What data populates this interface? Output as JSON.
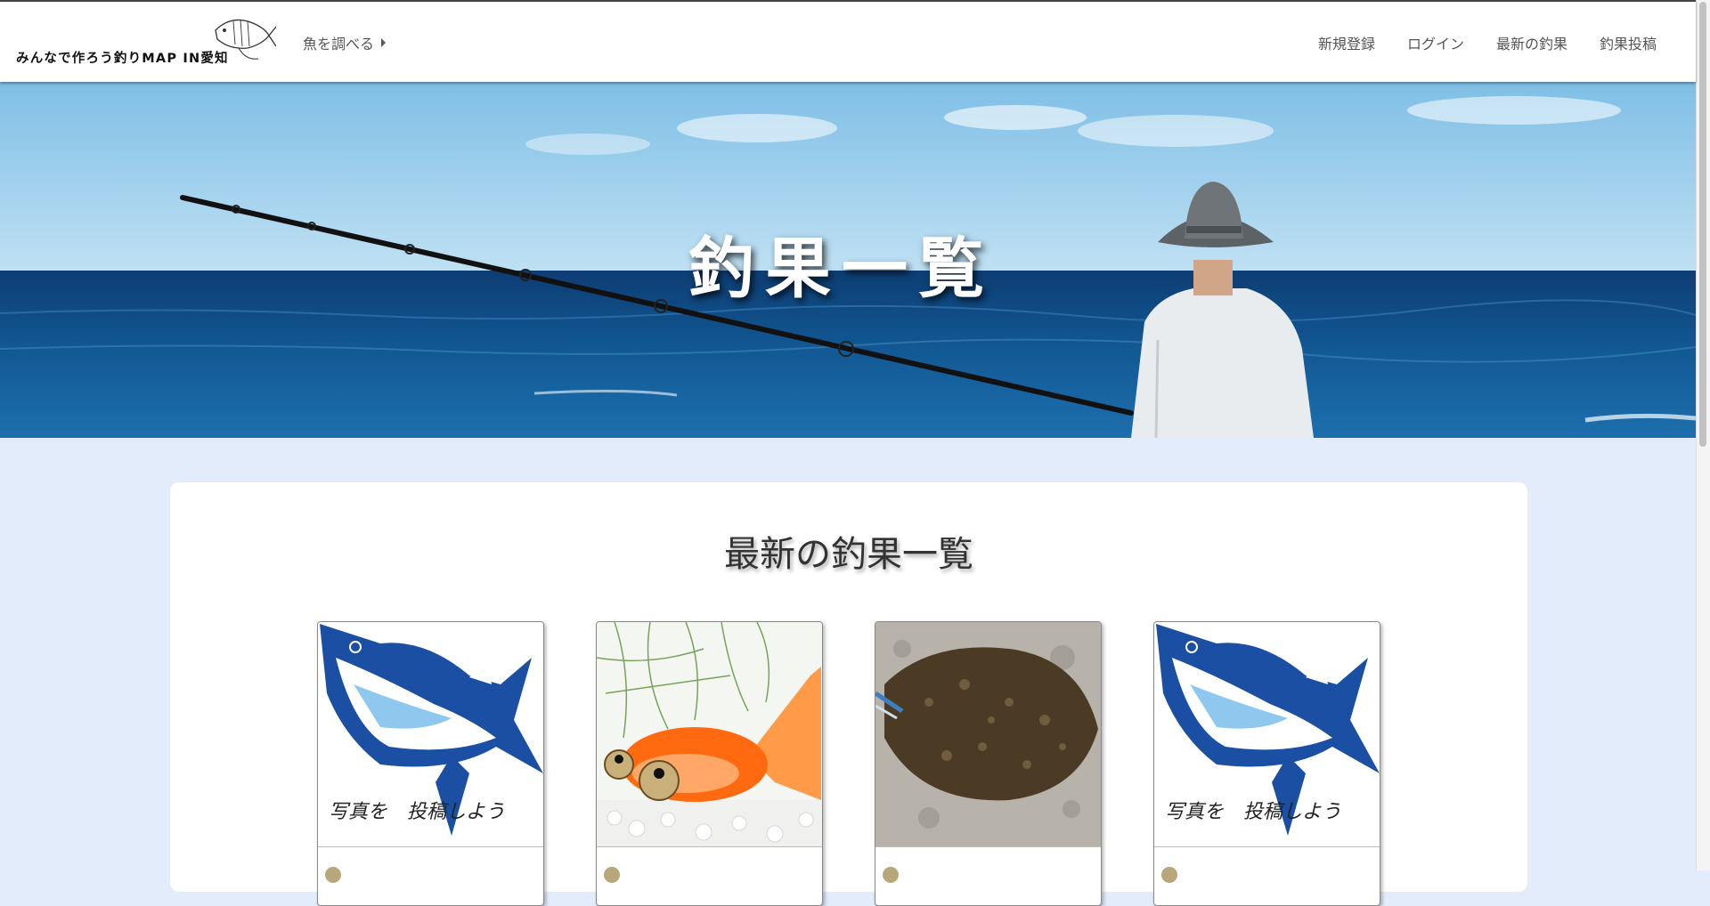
{
  "header": {
    "logo_text": "みんなで作ろう釣りMAP IN愛知",
    "fish_menu_label": "魚を調べる",
    "nav": [
      "新規登録",
      "ログイン",
      "最新の釣果",
      "釣果投稿"
    ]
  },
  "hero": {
    "title": "釣果一覧"
  },
  "main": {
    "heading": "最新の釣果一覧",
    "cards": [
      {
        "image": "tuna-placeholder-illustration",
        "caption": "写真を　投稿しよう"
      },
      {
        "image": "goldfish-photo"
      },
      {
        "image": "flatfish-photo"
      },
      {
        "image": "tuna-placeholder-illustration",
        "caption": "写真を　投稿しよう"
      }
    ]
  },
  "colors": {
    "page_background": "#e3ecfb",
    "tuna_blue": "#1a4fa3",
    "tuna_light": "#8ec8ef",
    "sea": "#0f4f86",
    "sky": "#7fc0e6"
  }
}
